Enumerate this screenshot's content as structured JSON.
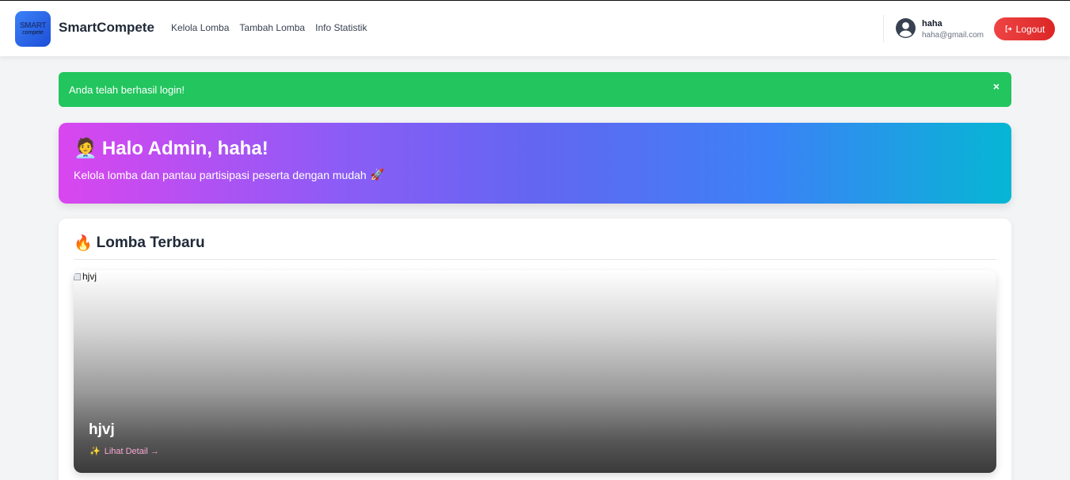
{
  "navbar": {
    "logo_line1": "SMART",
    "logo_line2": "compete",
    "brand": "SmartCompete",
    "links": [
      "Kelola Lomba",
      "Tambah Lomba",
      "Info Statistik"
    ],
    "user_name": "haha",
    "user_email": "haha@gmail.com",
    "logout_label": "Logout",
    "logout_icon": "logout-icon"
  },
  "alert": {
    "message": "Anda telah berhasil login!",
    "close_symbol": "×",
    "color": "#22c55e"
  },
  "hero": {
    "emoji": "🧑‍💼",
    "title": "Halo Admin, haha!",
    "subtitle": "Kelola lomba dan pantau partisipasi peserta dengan mudah",
    "subtitle_emoji": "🚀"
  },
  "latest": {
    "emoji": "🔥",
    "title": "Lomba Terbaru",
    "items": [
      {
        "image_alt": "hjvj",
        "name": "hjvj",
        "link_emoji": "✨",
        "link_label": "Lihat Detail →"
      }
    ]
  }
}
